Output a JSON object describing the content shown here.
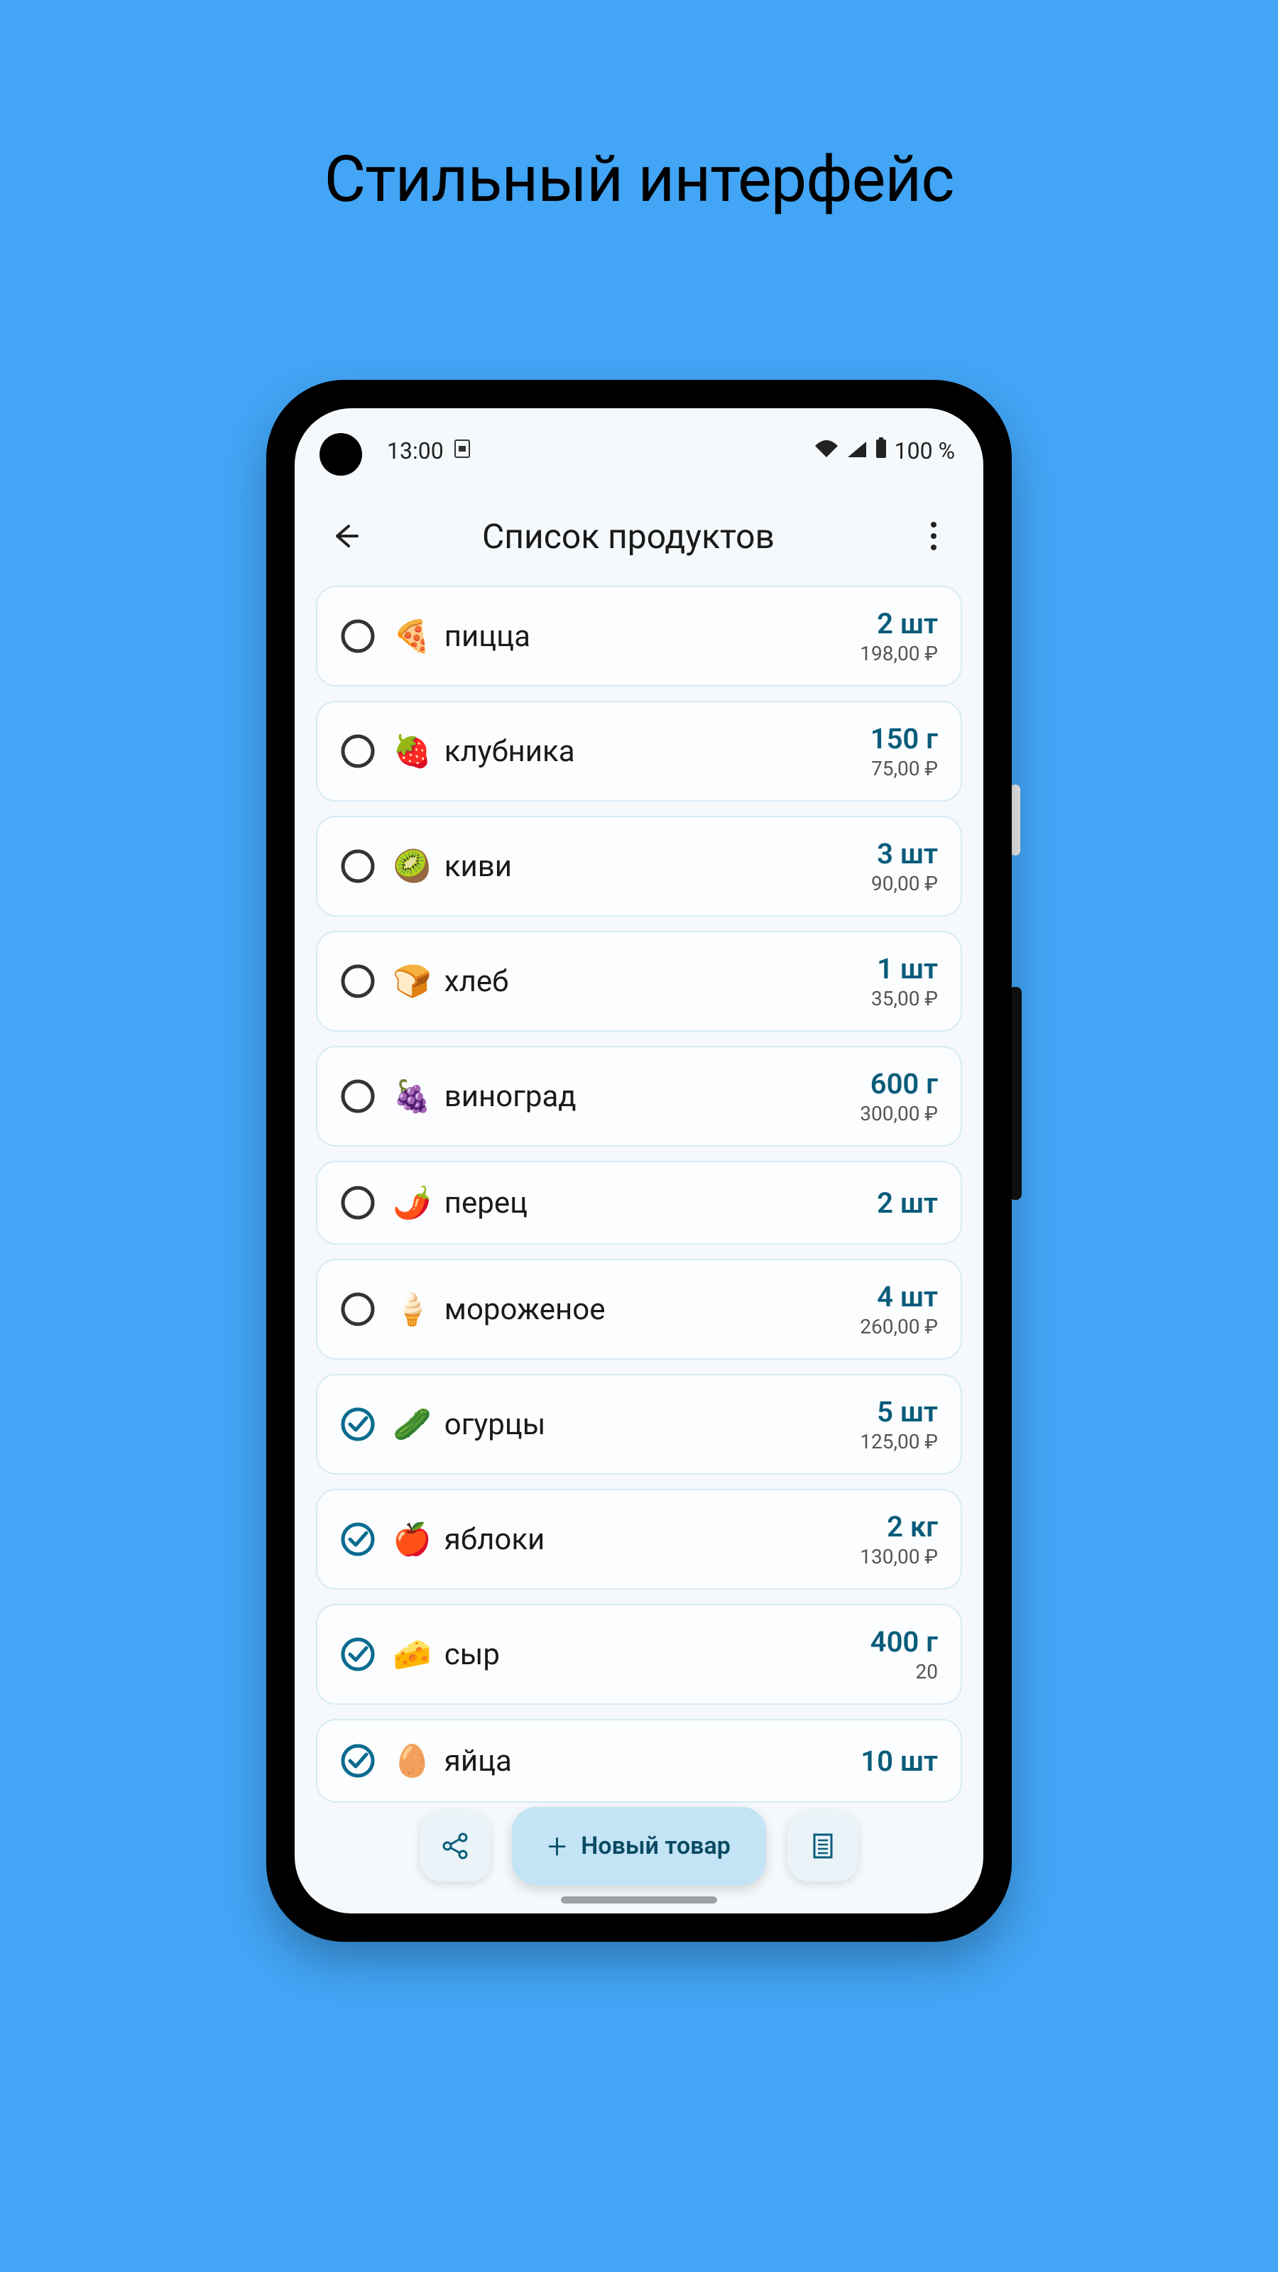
{
  "promo": {
    "title": "Стильный интерфейс"
  },
  "status": {
    "time": "13:00",
    "battery": "100 %"
  },
  "appbar": {
    "title": "Список продуктов"
  },
  "fab": {
    "label": "Новый товар"
  },
  "items": [
    {
      "emoji": "🍕",
      "name": "пицца",
      "qty": "2 шт",
      "price": "198,00 ₽",
      "checked": false
    },
    {
      "emoji": "🍓",
      "name": "клубника",
      "qty": "150 г",
      "price": "75,00 ₽",
      "checked": false
    },
    {
      "emoji": "🥝",
      "name": "киви",
      "qty": "3 шт",
      "price": "90,00 ₽",
      "checked": false
    },
    {
      "emoji": "🍞",
      "name": "хлеб",
      "qty": "1 шт",
      "price": "35,00 ₽",
      "checked": false
    },
    {
      "emoji": "🍇",
      "name": "виноград",
      "qty": "600 г",
      "price": "300,00 ₽",
      "checked": false
    },
    {
      "emoji": "🌶️",
      "name": "перец",
      "qty": "2 шт",
      "price": "",
      "checked": false
    },
    {
      "emoji": "🍦",
      "name": "мороженое",
      "qty": "4 шт",
      "price": "260,00 ₽",
      "checked": false
    },
    {
      "emoji": "🥒",
      "name": "огурцы",
      "qty": "5 шт",
      "price": "125,00 ₽",
      "checked": true
    },
    {
      "emoji": "🍎",
      "name": "яблоки",
      "qty": "2 кг",
      "price": "130,00 ₽",
      "checked": true
    },
    {
      "emoji": "🧀",
      "name": "сыр",
      "qty": "400 г",
      "price": "20",
      "checked": true
    },
    {
      "emoji": "🥚",
      "name": "яйца",
      "qty": "10 шт",
      "price": "",
      "checked": true
    }
  ]
}
